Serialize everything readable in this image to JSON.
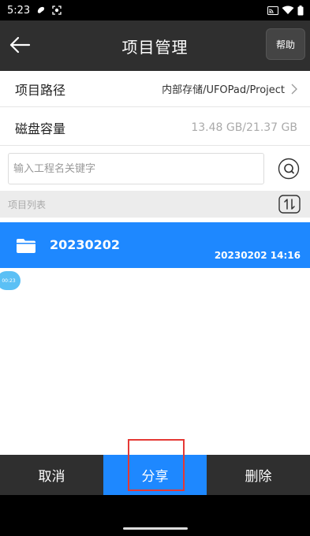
{
  "status_bar": {
    "time": "5:23",
    "icons": [
      "blob-icon",
      "focus-icon",
      "cast-icon",
      "wifi-icon",
      "battery-icon"
    ]
  },
  "app_bar": {
    "title": "项目管理",
    "help_label": "帮助",
    "back_icon": "arrow-left-icon"
  },
  "project_path": {
    "label": "项目路径",
    "value": "内部存储/UFOPad/Project"
  },
  "disk": {
    "label": "磁盘容量",
    "value": "13.48 GB/21.37 GB"
  },
  "search": {
    "placeholder": "输入工程名关键字",
    "value": ""
  },
  "list": {
    "header": "项目列表",
    "items": [
      {
        "name": "20230202",
        "date": "20230202 14:16"
      }
    ]
  },
  "float_badge": "00:23",
  "bottom_bar": {
    "cancel": "取消",
    "share": "分享",
    "delete": "删除"
  },
  "colors": {
    "accent": "#1e88ff",
    "appbar": "#2f2f2f",
    "highlight": "#e53935"
  }
}
